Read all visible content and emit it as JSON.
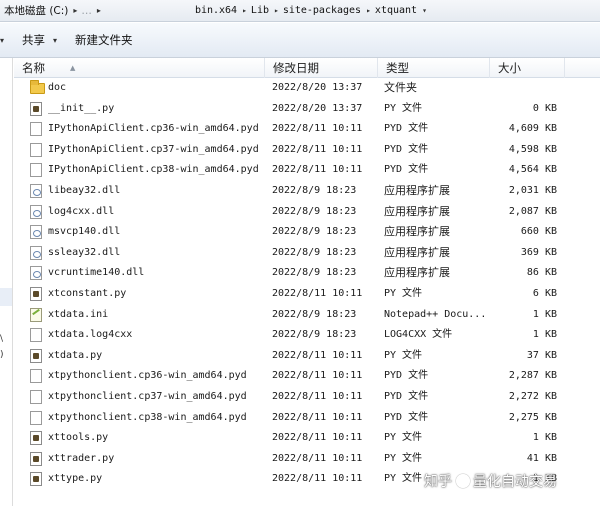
{
  "address": {
    "crumbs": [
      "本地磁盘 (C:)",
      "…",
      "bin.x64",
      "Lib",
      "site-packages",
      "xtquant"
    ]
  },
  "toolbar": {
    "share_label": "共享",
    "new_folder_label": "新建文件夹"
  },
  "columns": {
    "name": "名称",
    "date": "修改日期",
    "type": "类型",
    "size": "大小"
  },
  "nav_cut": [
    "\\",
    ")"
  ],
  "files": [
    {
      "name": "doc",
      "date": "2022/8/20 13:37",
      "type": "文件夹",
      "size": "",
      "icon": "folder-icon"
    },
    {
      "name": "__init__.py",
      "date": "2022/8/20 13:37",
      "type": "PY 文件",
      "size": "0 KB",
      "icon": "python-file-icon"
    },
    {
      "name": "IPythonApiClient.cp36-win_amd64.pyd",
      "date": "2022/8/11 10:11",
      "type": "PYD 文件",
      "size": "4,609 KB",
      "icon": "file-icon"
    },
    {
      "name": "IPythonApiClient.cp37-win_amd64.pyd",
      "date": "2022/8/11 10:11",
      "type": "PYD 文件",
      "size": "4,598 KB",
      "icon": "file-icon"
    },
    {
      "name": "IPythonApiClient.cp38-win_amd64.pyd",
      "date": "2022/8/11 10:11",
      "type": "PYD 文件",
      "size": "4,564 KB",
      "icon": "file-icon"
    },
    {
      "name": "libeay32.dll",
      "date": "2022/8/9 18:23",
      "type": "应用程序扩展",
      "size": "2,031 KB",
      "icon": "dll-icon"
    },
    {
      "name": "log4cxx.dll",
      "date": "2022/8/9 18:23",
      "type": "应用程序扩展",
      "size": "2,087 KB",
      "icon": "dll-icon"
    },
    {
      "name": "msvcp140.dll",
      "date": "2022/8/9 18:23",
      "type": "应用程序扩展",
      "size": "660 KB",
      "icon": "dll-icon"
    },
    {
      "name": "ssleay32.dll",
      "date": "2022/8/9 18:23",
      "type": "应用程序扩展",
      "size": "369 KB",
      "icon": "dll-icon"
    },
    {
      "name": "vcruntime140.dll",
      "date": "2022/8/9 18:23",
      "type": "应用程序扩展",
      "size": "86 KB",
      "icon": "dll-icon"
    },
    {
      "name": "xtconstant.py",
      "date": "2022/8/11 10:11",
      "type": "PY 文件",
      "size": "6 KB",
      "icon": "python-file-icon"
    },
    {
      "name": "xtdata.ini",
      "date": "2022/8/9 18:23",
      "type": "Notepad++ Docu...",
      "size": "1 KB",
      "icon": "ini-file-icon"
    },
    {
      "name": "xtdata.log4cxx",
      "date": "2022/8/9 18:23",
      "type": "LOG4CXX 文件",
      "size": "1 KB",
      "icon": "file-icon"
    },
    {
      "name": "xtdata.py",
      "date": "2022/8/11 10:11",
      "type": "PY 文件",
      "size": "37 KB",
      "icon": "python-file-icon"
    },
    {
      "name": "xtpythonclient.cp36-win_amd64.pyd",
      "date": "2022/8/11 10:11",
      "type": "PYD 文件",
      "size": "2,287 KB",
      "icon": "file-icon"
    },
    {
      "name": "xtpythonclient.cp37-win_amd64.pyd",
      "date": "2022/8/11 10:11",
      "type": "PYD 文件",
      "size": "2,272 KB",
      "icon": "file-icon"
    },
    {
      "name": "xtpythonclient.cp38-win_amd64.pyd",
      "date": "2022/8/11 10:11",
      "type": "PYD 文件",
      "size": "2,275 KB",
      "icon": "file-icon"
    },
    {
      "name": "xttools.py",
      "date": "2022/8/11 10:11",
      "type": "PY 文件",
      "size": "1 KB",
      "icon": "python-file-icon"
    },
    {
      "name": "xttrader.py",
      "date": "2022/8/11 10:11",
      "type": "PY 文件",
      "size": "41 KB",
      "icon": "python-file-icon"
    },
    {
      "name": "xttype.py",
      "date": "2022/8/11 10:11",
      "type": "PY 文件",
      "size": "1 KB",
      "icon": "python-file-icon"
    }
  ],
  "watermark": {
    "left": "知乎",
    "right": "量化自动交易"
  }
}
